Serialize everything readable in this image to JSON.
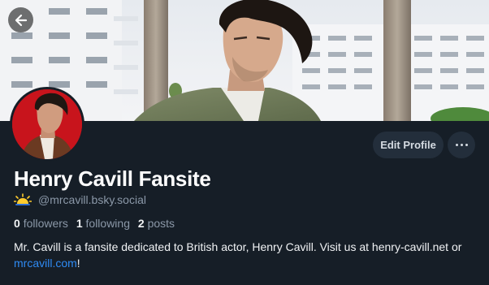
{
  "profile": {
    "display_name": "Henry Cavill Fansite",
    "handle": "@mrcavill.bsky.social",
    "followers_count": "0",
    "followers_label": "followers",
    "following_count": "1",
    "following_label": "following",
    "posts_count": "2",
    "posts_label": "posts",
    "bio_text": "Mr. Cavill is a fansite dedicated to British actor, Henry Cavill. Visit us at henry-cavill.net or ",
    "bio_link": "mrcavill.com",
    "bio_end": "!"
  },
  "actions": {
    "edit_profile_label": "Edit Profile"
  },
  "icons": {
    "back": "back-arrow-icon",
    "more": "more-options-icon",
    "handle": "sun-emoji-icon"
  },
  "colors": {
    "background": "#161e27",
    "button_bg": "#232e3b",
    "link": "#2f8bf4",
    "muted_text": "#8b98a8"
  }
}
